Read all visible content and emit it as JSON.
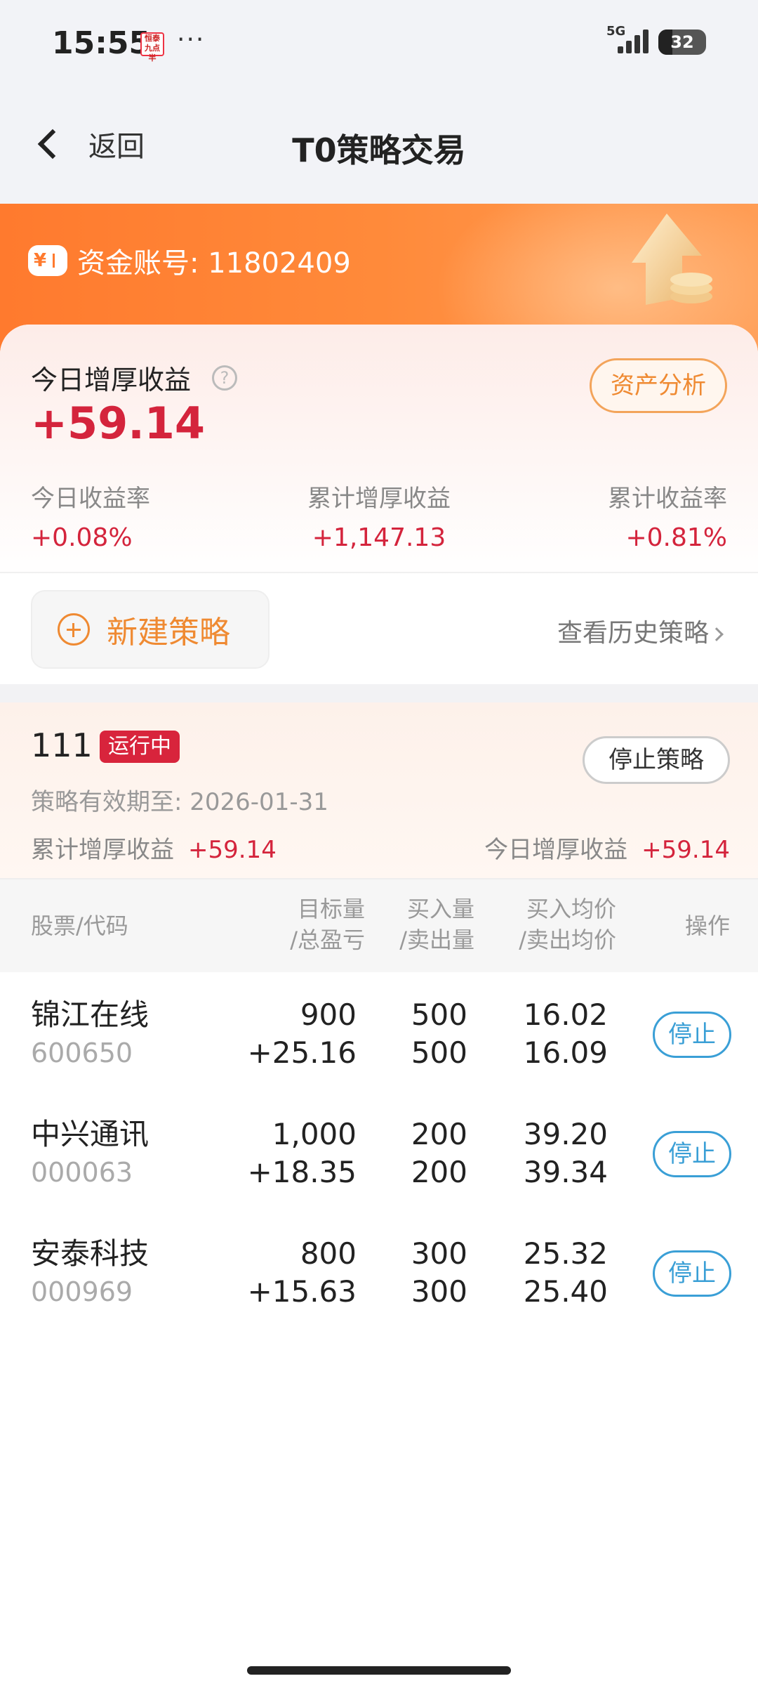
{
  "status_bar": {
    "time": "15:55",
    "network": "5G",
    "battery": "32",
    "more": "···"
  },
  "nav": {
    "back_label": "返回",
    "title": "T0策略交易"
  },
  "account": {
    "label": "资金账号: 11802409"
  },
  "summary": {
    "today_label": "今日增厚收益",
    "today_value": "+59.14",
    "asset_button": "资产分析",
    "stats": [
      {
        "label": "今日收益率",
        "value": "+0.08%"
      },
      {
        "label": "累计增厚收益",
        "value": "+1,147.13"
      },
      {
        "label": "累计收益率",
        "value": "+0.81%"
      }
    ],
    "new_strategy": "新建策略",
    "history": "查看历史策略"
  },
  "strategy": {
    "name": "111",
    "status": "运行中",
    "stop_button": "停止策略",
    "valid_until": "策略有效期至:  2026-01-31",
    "cum_label": "累计增厚收益",
    "cum_value": "+59.14",
    "today_label": "今日增厚收益",
    "today_value": "+59.14"
  },
  "table": {
    "headers": {
      "stock": "股票/代码",
      "target_1": "目标量",
      "target_2": "/总盈亏",
      "qty_1": "买入量",
      "qty_2": "/卖出量",
      "price_1": "买入均价",
      "price_2": "/卖出均价",
      "action": "操作"
    },
    "rows": [
      {
        "name": "锦江在线",
        "code": "600650",
        "target": "900",
        "pnl": "+25.16",
        "buy_qty": "500",
        "sell_qty": "500",
        "buy_price": "16.02",
        "sell_price": "16.09",
        "action": "停止"
      },
      {
        "name": "中兴通讯",
        "code": "000063",
        "target": "1,000",
        "pnl": "+18.35",
        "buy_qty": "200",
        "sell_qty": "200",
        "buy_price": "39.20",
        "sell_price": "39.34",
        "action": "停止"
      },
      {
        "name": "安泰科技",
        "code": "000969",
        "target": "800",
        "pnl": "+15.63",
        "buy_qty": "300",
        "sell_qty": "300",
        "buy_price": "25.32",
        "sell_price": "25.40",
        "action": "停止"
      }
    ]
  },
  "colors": {
    "accent_orange": "#ef8a32",
    "profit_red": "#d4243c",
    "action_blue": "#3a9fd6"
  }
}
